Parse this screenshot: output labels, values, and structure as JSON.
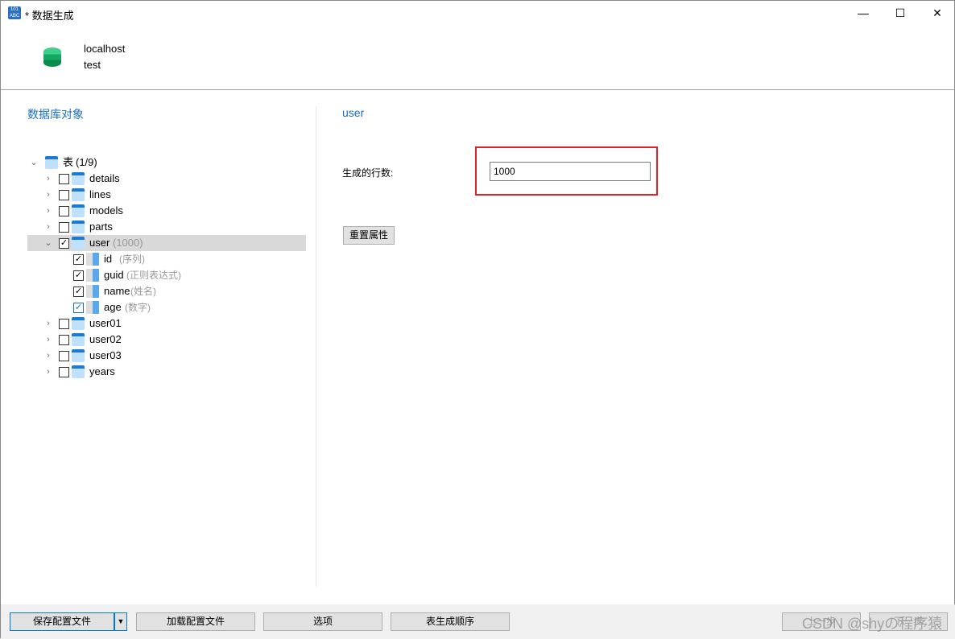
{
  "window": {
    "title": "* 数据生成",
    "minimize": "—",
    "maximize": "☐",
    "close": "✕"
  },
  "header": {
    "host": "localhost",
    "database": "test"
  },
  "left": {
    "title": "数据库对象",
    "root": {
      "label": "表",
      "count": "(1/9)"
    },
    "tables": [
      {
        "name": "details",
        "checked": false
      },
      {
        "name": "lines",
        "checked": false
      },
      {
        "name": "models",
        "checked": false
      },
      {
        "name": "parts",
        "checked": false
      },
      {
        "name": "user",
        "checked": true,
        "extra": "(1000)"
      },
      {
        "name": "user01",
        "checked": false
      },
      {
        "name": "user02",
        "checked": false
      },
      {
        "name": "user03",
        "checked": false
      },
      {
        "name": "years",
        "checked": false
      }
    ],
    "columns": [
      {
        "name": "id",
        "type": "(序列)"
      },
      {
        "name": "guid",
        "type": "(正则表达式)"
      },
      {
        "name": "name",
        "type": "(姓名)"
      },
      {
        "name": "age",
        "type": "(数字)"
      }
    ]
  },
  "right": {
    "title": "user",
    "rows_label": "生成的行数:",
    "rows_value": "1000",
    "reset": "重置属性"
  },
  "footer": {
    "save": "保存配置文件",
    "load": "加载配置文件",
    "options": "选项",
    "order": "表生成顺序",
    "prev": "上一步",
    "next": "下一步"
  },
  "watermark": "CSDN @shyの程序猿"
}
